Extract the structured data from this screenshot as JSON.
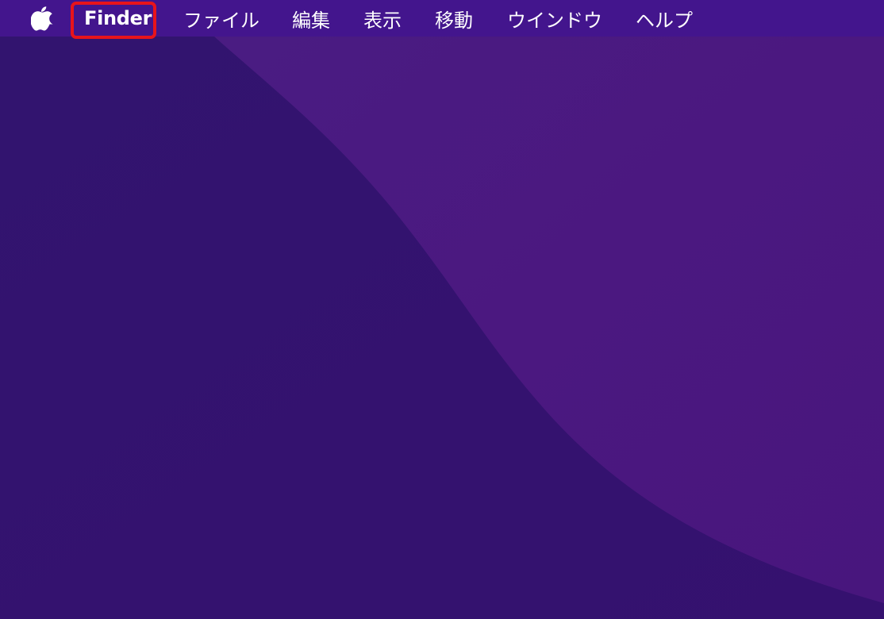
{
  "desktop": {
    "colors": {
      "base": "#361575",
      "lighter_region": "#4a1a80",
      "menubar": "#4a1796",
      "highlight": "#e8141b",
      "text": "#ffffff"
    }
  },
  "menubar": {
    "apple_icon": "apple-logo-icon",
    "app_name": "Finder",
    "items": [
      {
        "label": "ファイル"
      },
      {
        "label": "編集"
      },
      {
        "label": "表示"
      },
      {
        "label": "移動"
      },
      {
        "label": "ウインドウ"
      },
      {
        "label": "ヘルプ"
      }
    ]
  }
}
